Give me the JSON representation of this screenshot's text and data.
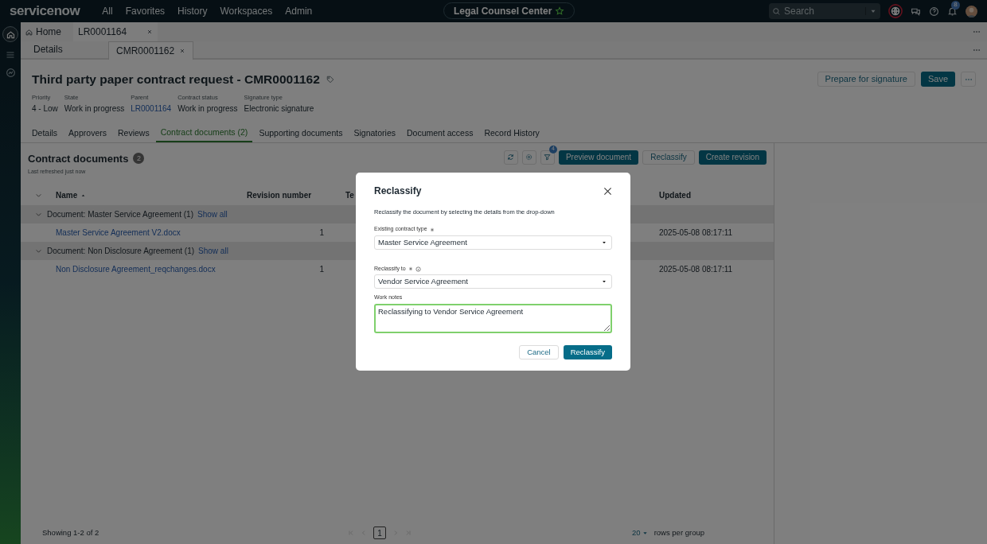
{
  "topbar": {
    "logo": "servicenow",
    "nav": [
      "All",
      "Favorites",
      "History",
      "Workspaces",
      "Admin"
    ],
    "workspace": "Legal Counsel Center",
    "search": {
      "placeholder": "Search"
    },
    "notifications": "8"
  },
  "record_tabs": [
    {
      "label": "Home",
      "kind": "home",
      "selected": false
    },
    {
      "label": "LR0001164",
      "kind": "record",
      "selected": true
    }
  ],
  "sub_tabs": [
    {
      "label": "Details",
      "closable": false,
      "selected": false
    },
    {
      "label": "CMR0001162",
      "closable": true,
      "selected": true
    }
  ],
  "header": {
    "title": "Third party paper contract request - CMR0001162",
    "actions": [
      {
        "label": "Prepare for signature",
        "primary": false
      },
      {
        "label": "Save",
        "primary": true
      }
    ],
    "fields": [
      {
        "label": "Priority",
        "value": "4 - Low",
        "link": false
      },
      {
        "label": "State",
        "value": "Work in progress",
        "link": false
      },
      {
        "label": "Parent",
        "value": "LR0001164",
        "link": true
      },
      {
        "label": "Contract status",
        "value": "Work in progress",
        "link": false
      },
      {
        "label": "Signature type",
        "value": "Electronic signature",
        "link": false
      }
    ]
  },
  "section_tabs": [
    {
      "label": "Details",
      "selected": false
    },
    {
      "label": "Approvers",
      "selected": false
    },
    {
      "label": "Reviews",
      "selected": false
    },
    {
      "label": "Contract documents (2)",
      "selected": true
    },
    {
      "label": "Supporting documents",
      "selected": false
    },
    {
      "label": "Signatories",
      "selected": false
    },
    {
      "label": "Document access",
      "selected": false
    },
    {
      "label": "Record History",
      "selected": false
    }
  ],
  "documents": {
    "title": "Contract documents",
    "count": "2",
    "refreshed": "Last refreshed just now",
    "filter_count": "4",
    "buttons": [
      {
        "label": "Preview document",
        "primary": true
      },
      {
        "label": "Reclassify",
        "primary": false
      },
      {
        "label": "Create revision",
        "primary": true
      }
    ],
    "columns": [
      "Name",
      "Revision number",
      "Te",
      "Updated"
    ],
    "groups": [
      {
        "label": "Document: Master Service Agreement (1)",
        "link": "Show all",
        "expanded": true,
        "rows": [
          {
            "name": "Master Service Agreement V2.docx",
            "revision": "1",
            "updated": "2025-05-08 08:17:11"
          }
        ]
      },
      {
        "label": "Document: Non Disclosure Agreement (1)",
        "link": "Show all",
        "expanded": true,
        "rows": [
          {
            "name": "Non Disclosure Agreement_reqchanges.docx",
            "revision": "1",
            "updated": "2025-05-08 08:17:11"
          }
        ]
      }
    ],
    "footer": {
      "showing": "Showing 1-2 of 2",
      "page": "1",
      "rows_per_group": "20",
      "rows_label": "rows per group"
    }
  },
  "dialog": {
    "title": "Reclassify",
    "description": "Reclassify the document by selecting the details from the drop-down",
    "fields": [
      {
        "kind": "select",
        "label": "Existing contract type",
        "required": true,
        "info": false,
        "value": "Master Service Agreement"
      },
      {
        "kind": "select",
        "label": "Reclassify to",
        "required": true,
        "info": true,
        "value": "Vendor Service Agreement"
      },
      {
        "kind": "textarea",
        "label": "Work notes",
        "required": false,
        "info": false,
        "value": "Reclassifying to Vendor Service Agreement"
      }
    ],
    "buttons": [
      {
        "label": "Cancel",
        "primary": false
      },
      {
        "label": "Reclassify",
        "primary": true
      }
    ]
  }
}
